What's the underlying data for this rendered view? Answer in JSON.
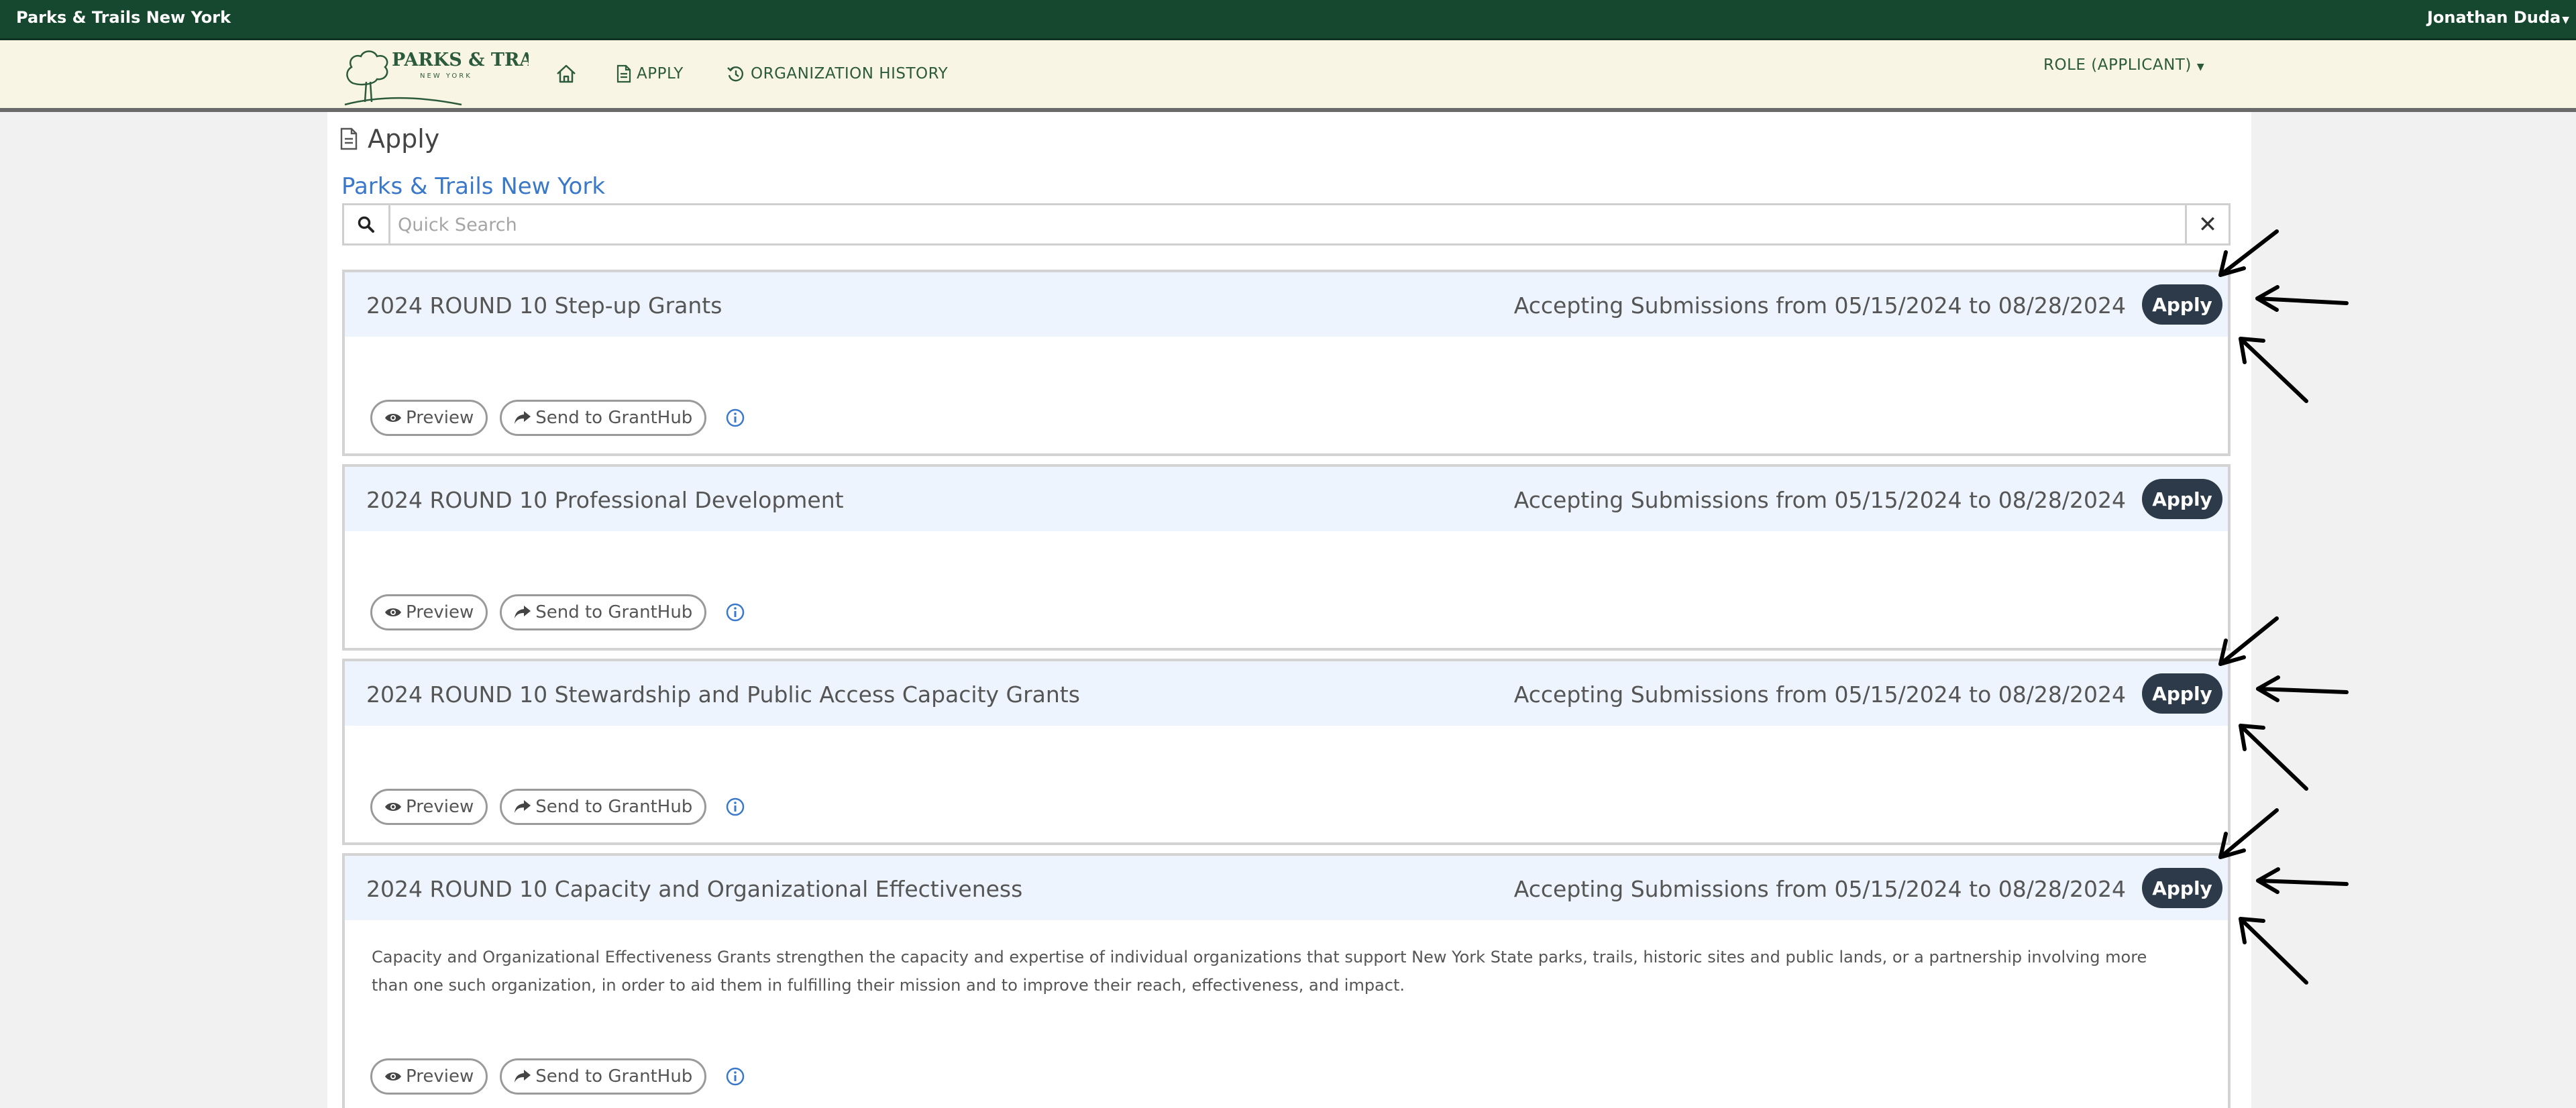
{
  "topbar": {
    "site_name": "Parks & Trails New York",
    "user_name": "Jonathan Duda"
  },
  "nav": {
    "logo_text": "PARKS & TRAILS",
    "logo_subtext": "NEW YORK",
    "apply_label": "APPLY",
    "history_label": "ORGANIZATION HISTORY",
    "role_label": "ROLE (APPLICANT)"
  },
  "page": {
    "title": "Apply",
    "organization": "Parks & Trails New York"
  },
  "search": {
    "placeholder": "Quick Search",
    "value": ""
  },
  "cards": [
    {
      "title": "2024 ROUND 10 Step-up Grants",
      "accepting": "Accepting Submissions from 05/15/2024 to 08/28/2024",
      "apply_label": "Apply",
      "description": "",
      "preview_label": "Preview",
      "send_label": "Send to GrantHub"
    },
    {
      "title": "2024 ROUND 10 Professional Development",
      "accepting": "Accepting Submissions from 05/15/2024 to 08/28/2024",
      "apply_label": "Apply",
      "description": "",
      "preview_label": "Preview",
      "send_label": "Send to GrantHub"
    },
    {
      "title": "2024 ROUND 10 Stewardship and Public Access Capacity Grants",
      "accepting": "Accepting Submissions from 05/15/2024 to 08/28/2024",
      "apply_label": "Apply",
      "description": "",
      "preview_label": "Preview",
      "send_label": "Send to GrantHub"
    },
    {
      "title": "2024 ROUND 10 Capacity and Organizational Effectiveness",
      "accepting": "Accepting Submissions from 05/15/2024 to 08/28/2024",
      "apply_label": "Apply",
      "description": "Capacity and Organizational Effectiveness Grants strengthen the capacity and expertise of individual organizations that support New York State parks, trails, historic sites and public lands, or a partnership involving more than one such organization, in order to aid them in fulfilling their mission and to improve their reach, effectiveness, and impact.",
      "preview_label": "Preview",
      "send_label": "Send to GrantHub"
    }
  ],
  "colors": {
    "topbar": "#16482f",
    "navbar": "#f9f5e4",
    "brand_green": "#2c5a3c",
    "link_blue": "#3a78c9",
    "apply_button": "#2d3a49",
    "card_header": "#eef4fd"
  },
  "icons": [
    "home-icon",
    "document-icon",
    "history-icon",
    "search-icon",
    "close-icon",
    "eye-icon",
    "share-icon",
    "info-icon",
    "arrow-annotation"
  ]
}
